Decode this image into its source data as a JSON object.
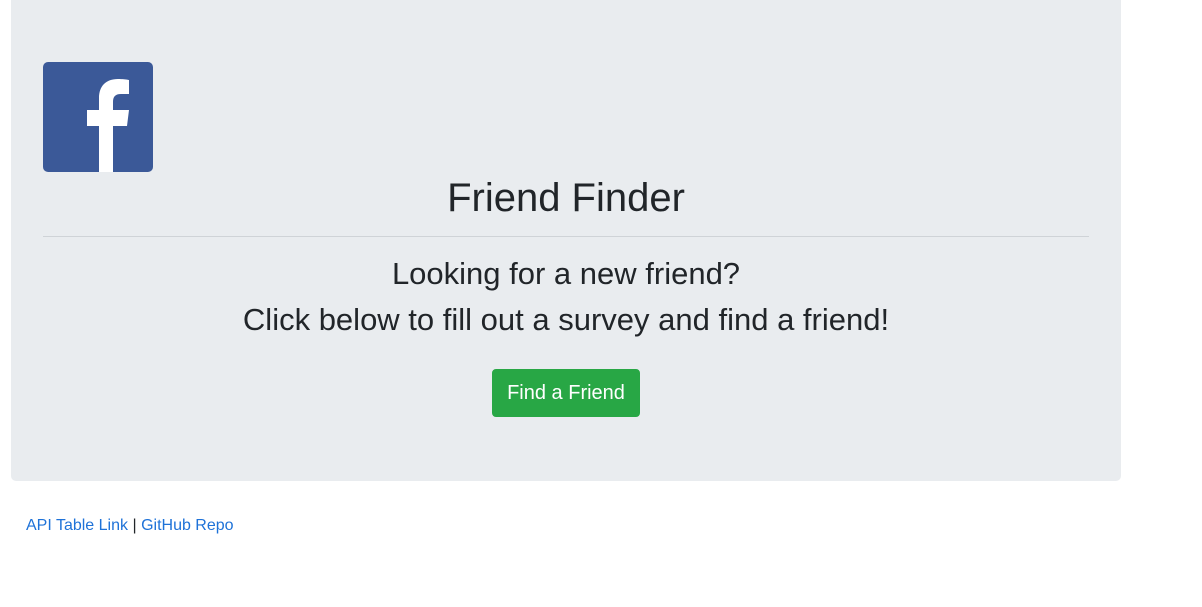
{
  "header": {
    "logo_icon": "facebook-icon",
    "logo_color": "#3b5998",
    "title": "Friend Finder",
    "subtitle_line1": "Looking for a new friend?",
    "subtitle_line2": "Click below to fill out a survey and find a friend!"
  },
  "cta": {
    "label": "Find a Friend",
    "color": "#28a745"
  },
  "footer": {
    "link_api": "API Table Link",
    "separator": "|",
    "link_github": "GitHub Repo",
    "link_color": "#1e72d8"
  },
  "colors": {
    "jumbotron_bg": "#e9ecef",
    "text": "#212529"
  }
}
